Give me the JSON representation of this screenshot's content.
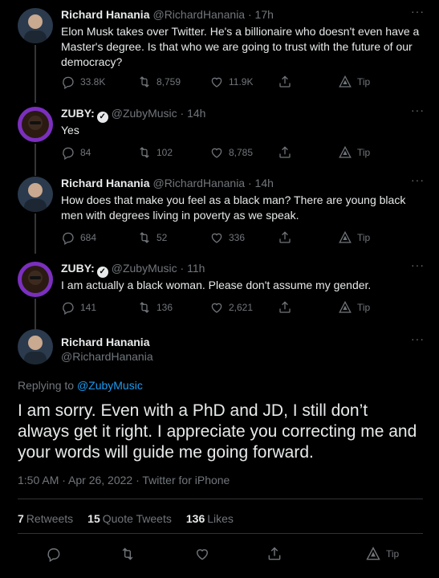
{
  "thread": [
    {
      "name": "Richard Hanania",
      "handle": "@RichardHanania · 17h",
      "text": "Elon Musk takes over Twitter. He's a billionaire who doesn't even have a Master's degree. Is that who we are going to trust with the future of our democracy?",
      "replies": "33.8K",
      "retweets": "8,759",
      "likes": "11.9K",
      "tip": "Tip"
    },
    {
      "name": "ZUBY:",
      "handle": "@ZubyMusic · 14h",
      "text": "Yes",
      "replies": "84",
      "retweets": "102",
      "likes": "8,785",
      "tip": "Tip"
    },
    {
      "name": "Richard Hanania",
      "handle": "@RichardHanania · 14h",
      "text": "How does that make you feel as a black man? There are young black men with degrees living in poverty as we speak.",
      "replies": "684",
      "retweets": "52",
      "likes": "336",
      "tip": "Tip"
    },
    {
      "name": "ZUBY:",
      "handle": "@ZubyMusic · 11h",
      "text": "I am actually a black woman. Please don't assume my gender.",
      "replies": "141",
      "retweets": "136",
      "likes": "2,621",
      "tip": "Tip"
    }
  ],
  "main": {
    "name": "Richard Hanania",
    "handle": "@RichardHanania",
    "replying_prefix": "Replying to",
    "replying_to": "@ZubyMusic",
    "text": "I am sorry. Even with a PhD and JD, I still don’t always get it right. I appreciate you correcting me and your words will guide me going forward.",
    "meta": "1:50 AM · Apr 26, 2022 · Twitter for iPhone",
    "retweets_count": "7",
    "retweets_label": "Retweets",
    "quotes_count": "15",
    "quotes_label": "Quote Tweets",
    "likes_count": "136",
    "likes_label": "Likes",
    "tip": "Tip"
  },
  "more_icon": "···",
  "colors": {
    "background": "#000000",
    "text": "#e7e9ea",
    "muted": "#71767b",
    "link": "#1d9bf0",
    "zuby_avatar": "#7b2fbe"
  }
}
